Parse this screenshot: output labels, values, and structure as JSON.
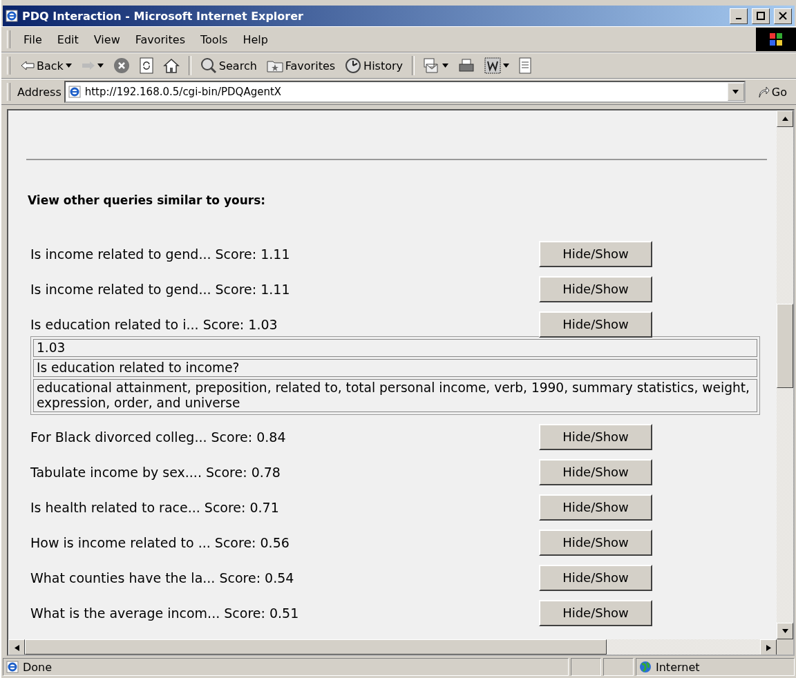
{
  "window": {
    "title": "PDQ Interaction - Microsoft Internet Explorer"
  },
  "menu": [
    "File",
    "Edit",
    "View",
    "Favorites",
    "Tools",
    "Help"
  ],
  "toolbar": [
    {
      "kind": "back",
      "label": "Back"
    },
    {
      "kind": "forward"
    },
    {
      "kind": "stop"
    },
    {
      "kind": "refresh"
    },
    {
      "kind": "home"
    },
    {
      "kind": "sep"
    },
    {
      "kind": "search",
      "label": "Search"
    },
    {
      "kind": "favorites",
      "label": "Favorites"
    },
    {
      "kind": "history",
      "label": "History"
    },
    {
      "kind": "sep"
    },
    {
      "kind": "mail"
    },
    {
      "kind": "print"
    },
    {
      "kind": "edit"
    },
    {
      "kind": "discuss"
    }
  ],
  "address": {
    "label": "Address",
    "value": "http://192.168.0.5/cgi-bin/PDQAgentX",
    "go": "Go"
  },
  "page": {
    "heading": "View other queries similar to yours:",
    "results": [
      {
        "text": "Is income related to gend... Score: 1.11",
        "button": "Hide/Show",
        "expanded": false
      },
      {
        "text": "Is income related to gend... Score: 1.11",
        "button": "Hide/Show",
        "expanded": false
      },
      {
        "text": "Is education related to i... Score: 1.03",
        "button": "Hide/Show",
        "expanded": true,
        "details": [
          "1.03",
          "Is education related to income?",
          "educational attainment, preposition, related to, total personal income, verb, 1990, summary statistics, weight, expression, order, and universe"
        ]
      },
      {
        "text": "For Black divorced colleg... Score: 0.84",
        "button": "Hide/Show",
        "expanded": false
      },
      {
        "text": "Tabulate income by sex.... Score: 0.78",
        "button": "Hide/Show",
        "expanded": false
      },
      {
        "text": "Is health related to race... Score: 0.71",
        "button": "Hide/Show",
        "expanded": false
      },
      {
        "text": "How is income related to ... Score: 0.56",
        "button": "Hide/Show",
        "expanded": false
      },
      {
        "text": "What counties have the la... Score: 0.54",
        "button": "Hide/Show",
        "expanded": false
      },
      {
        "text": "What is the average incom... Score: 0.51",
        "button": "Hide/Show",
        "expanded": false
      }
    ]
  },
  "status_bar": {
    "text": "Done",
    "zone": "Internet"
  }
}
